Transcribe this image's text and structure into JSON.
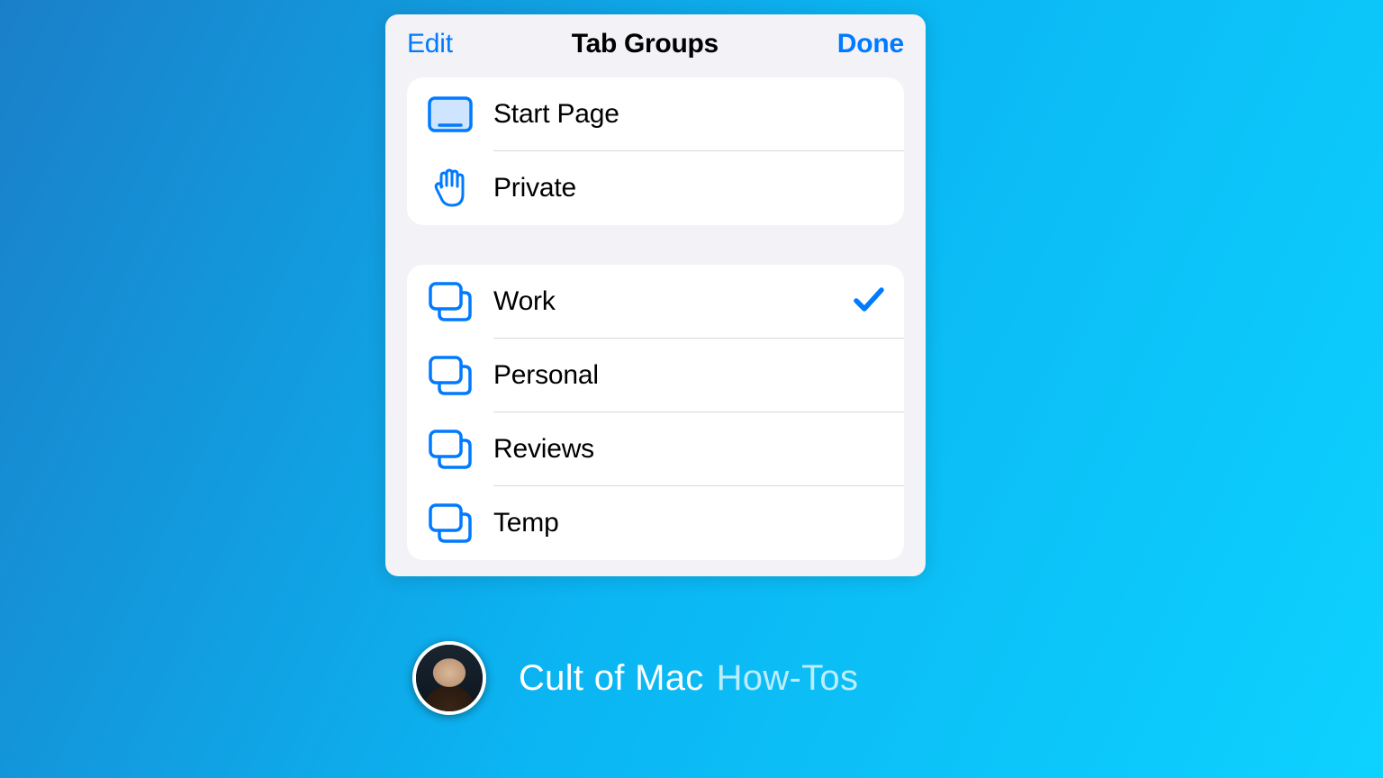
{
  "nav": {
    "edit": "Edit",
    "title": "Tab Groups",
    "done": "Done"
  },
  "defaults": {
    "start_page": "Start Page",
    "private": "Private"
  },
  "groups": {
    "work": "Work",
    "personal": "Personal",
    "reviews": "Reviews",
    "temp": "Temp",
    "selected": "Work"
  },
  "footer": {
    "brand": "Cult of Mac",
    "section": "How-Tos"
  },
  "colors": {
    "accent": "#007aff"
  }
}
